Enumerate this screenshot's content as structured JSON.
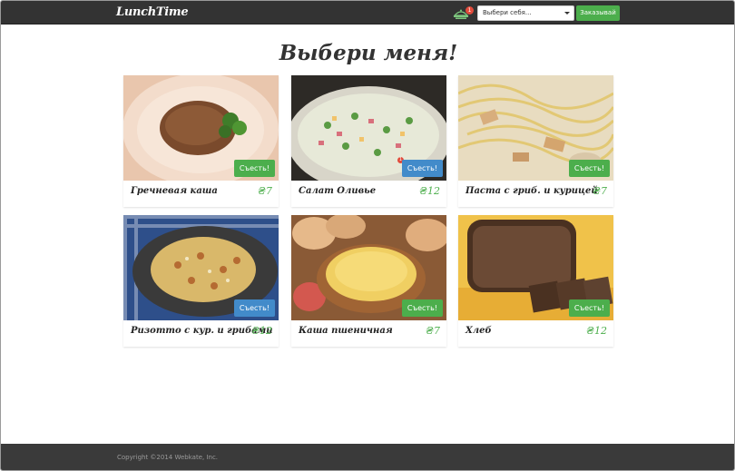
{
  "navbar": {
    "brand": "LunchTime",
    "cart_count": "1",
    "select_value": "Выбери себя...",
    "order_label": "Заказывай"
  },
  "main": {
    "headline": "Выбери меня!",
    "eat_label": "Съесть!",
    "items": [
      {
        "name": "Гречневая каша",
        "price": "₴7",
        "button_color": "#4cae4c",
        "image": "buckwheat"
      },
      {
        "name": "Салат Оливье",
        "price": "₴12",
        "button_color": "#428bca",
        "badge": "1",
        "image": "olivier-salad"
      },
      {
        "name": "Паста с гриб. и курицей",
        "price": "₴7",
        "button_color": "#4cae4c",
        "image": "pasta"
      },
      {
        "name": "Ризотто с кур. и грибами",
        "price": "₴12",
        "button_color": "#428bca",
        "image": "risotto"
      },
      {
        "name": "Каша пшеничная",
        "price": "₴7",
        "button_color": "#4cae4c",
        "image": "wheat-porridge"
      },
      {
        "name": "Хлеб",
        "price": "₴12",
        "button_color": "#4cae4c",
        "image": "bread"
      }
    ]
  },
  "footer": {
    "copyright": "Copyright ©2014 Webkate, Inc."
  },
  "colors": {
    "navbar": "#333333",
    "footer": "#3a3a3a",
    "green": "#4cae4c",
    "blue": "#428bca",
    "badge": "#e24b3b"
  }
}
